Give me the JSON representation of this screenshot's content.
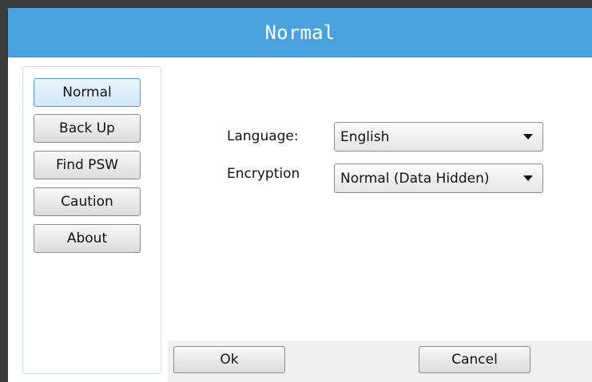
{
  "window": {
    "title": "Normal"
  },
  "sidebar": {
    "items": [
      {
        "label": "Normal",
        "active": true
      },
      {
        "label": "Back Up",
        "active": false
      },
      {
        "label": "Find PSW",
        "active": false
      },
      {
        "label": "Caution",
        "active": false
      },
      {
        "label": "About",
        "active": false
      }
    ]
  },
  "settings": {
    "language": {
      "label": "Language:",
      "selected": "English"
    },
    "encryption": {
      "label": "Encryption",
      "selected": "Normal (Data Hidden)"
    }
  },
  "footer": {
    "ok_label": "Ok",
    "cancel_label": "Cancel"
  },
  "colors": {
    "titlebar": "#4aa3df",
    "active_button": "#cfe7f9",
    "window_frame": "#3b3b3b"
  }
}
